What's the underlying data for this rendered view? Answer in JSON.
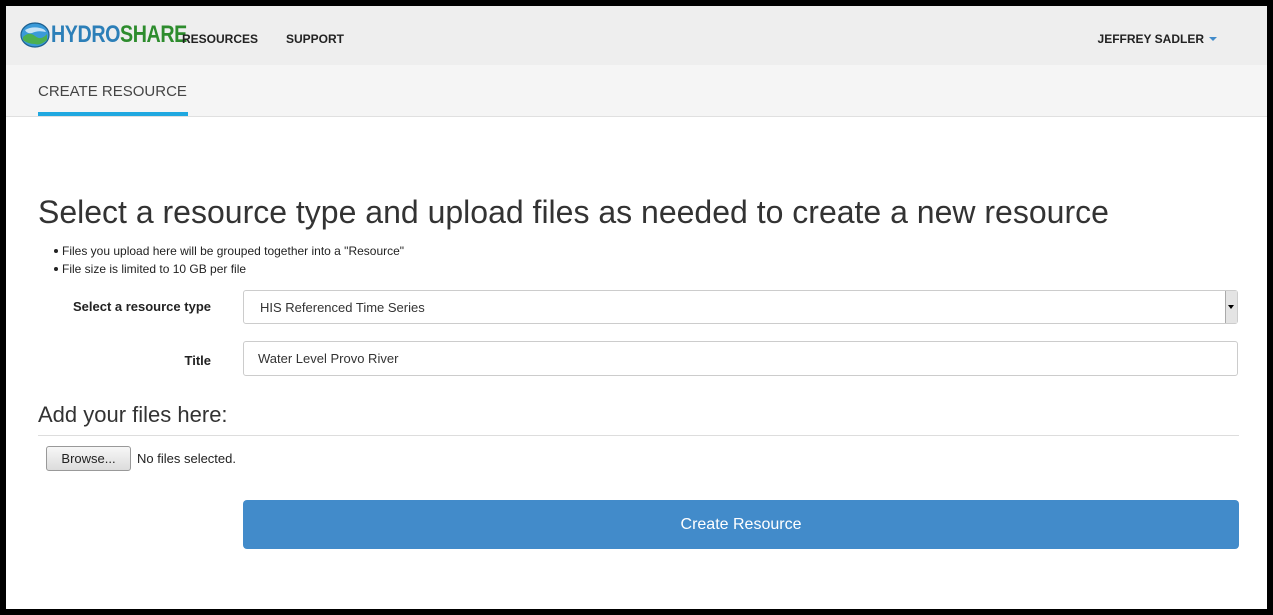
{
  "navbar": {
    "logo": {
      "part1": "HYDRO",
      "part2": "SHARE"
    },
    "links": [
      {
        "label": "RESOURCES"
      },
      {
        "label": "SUPPORT"
      }
    ],
    "user": {
      "name": "JEFFREY SADLER"
    }
  },
  "subnav": {
    "tab_label": "CREATE RESOURCE"
  },
  "main": {
    "title": "Select a resource type and upload files as needed to create a new resource",
    "notes": [
      "Files you upload here will be grouped together into a \"Resource\"",
      "File size is limited to 10 GB per file"
    ],
    "resource_type": {
      "label": "Select a resource type",
      "selected": "HIS Referenced Time Series"
    },
    "title_field": {
      "label": "Title",
      "value": "Water Level Provo River"
    },
    "files": {
      "heading": "Add your files here:",
      "browse_label": "Browse...",
      "status": "No files selected."
    },
    "create_button": {
      "label": "Create Resource"
    }
  },
  "colors": {
    "accent": "#428bca",
    "tab_underline": "#20a8e0",
    "logo_blue": "#2c7fb8",
    "logo_green": "#2d8c2d"
  }
}
